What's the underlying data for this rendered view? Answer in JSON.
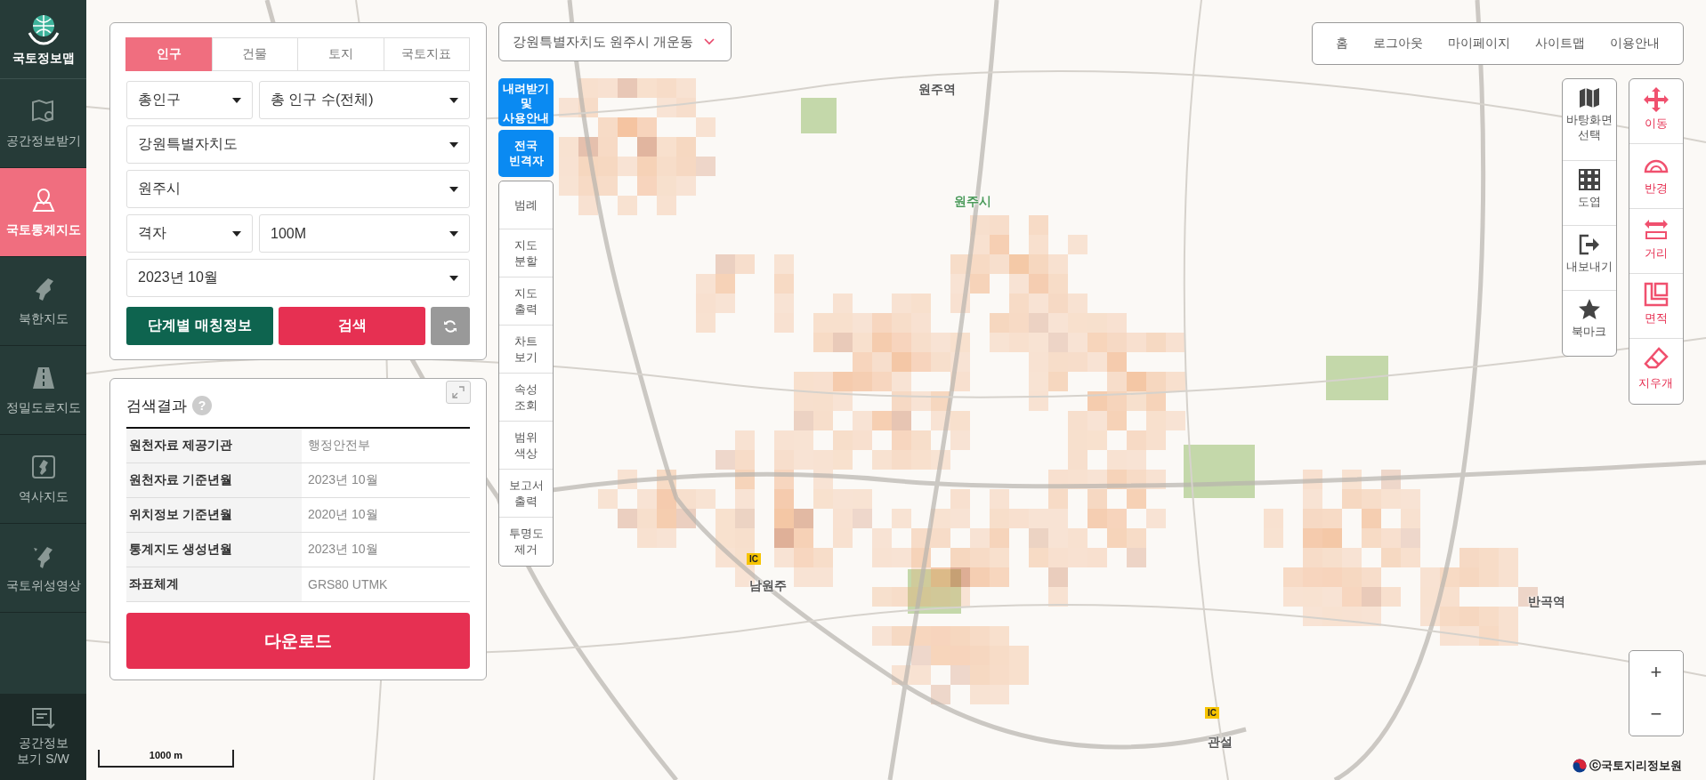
{
  "sidebar": {
    "logo": "국토정보맵",
    "items": [
      {
        "label": "공간정보받기",
        "selected": false
      },
      {
        "label": "국토통계지도",
        "selected": true
      },
      {
        "label": "북한지도",
        "selected": false
      },
      {
        "label": "정밀도로지도",
        "selected": false
      },
      {
        "label": "역사지도",
        "selected": false
      },
      {
        "label": "국토위성영상",
        "selected": false
      }
    ],
    "footer": "공간정보 보기 S/W"
  },
  "query_panel": {
    "tabs": [
      {
        "label": "인구",
        "selected": true
      },
      {
        "label": "건물",
        "selected": false
      },
      {
        "label": "토지",
        "selected": false
      },
      {
        "label": "국토지표",
        "selected": false
      }
    ],
    "selects": [
      [
        "총인구",
        "총 인구 수(전체)"
      ],
      [
        "강원특별자치도"
      ],
      [
        "원주시"
      ],
      [
        "격자",
        "100M"
      ],
      [
        "2023년 10월"
      ]
    ],
    "matching_button": "단계별 매칭정보",
    "search_button": "검색"
  },
  "results_panel": {
    "title": "검색결과",
    "help": "?",
    "rows": [
      {
        "label": "원천자료 제공기관",
        "value": "행정안전부"
      },
      {
        "label": "원천자료 기준년월",
        "value": "2023년 10월"
      },
      {
        "label": "위치정보 기준년월",
        "value": "2020년 10월"
      },
      {
        "label": "통계지도 생성년월",
        "value": "2023년 10월"
      },
      {
        "label": "좌표체계",
        "value": "GRS80 UTMK"
      }
    ],
    "download_button": "다운로드"
  },
  "location_select": "강원특별자치도 원주시 개운동",
  "quick_buttons": [
    "내려받기 및 사용안내",
    "전국 빈격자"
  ],
  "side_tools": [
    "범례",
    "지도 분할",
    "지도 출력",
    "차트 보기",
    "속성 조회",
    "범위 색상",
    "보고서 출력",
    "투명도 제거"
  ],
  "top_nav": [
    "홈",
    "로그아웃",
    "마이페이지",
    "사이트맵",
    "이용안내"
  ],
  "map_tools": [
    "바탕화면 선택",
    "도엽",
    "내보내기",
    "북마크"
  ],
  "measure_tools": [
    "이동",
    "반경",
    "거리",
    "면적",
    "지우개"
  ],
  "zoom": [
    "+",
    "−"
  ],
  "map_labels": [
    "원주역",
    "원주시",
    "남원주",
    "관설",
    "반곡역"
  ],
  "ic_badges": [
    "IC",
    "IC"
  ],
  "scale": "1000 m",
  "attribution": "ⓒ국토지리정보원"
}
